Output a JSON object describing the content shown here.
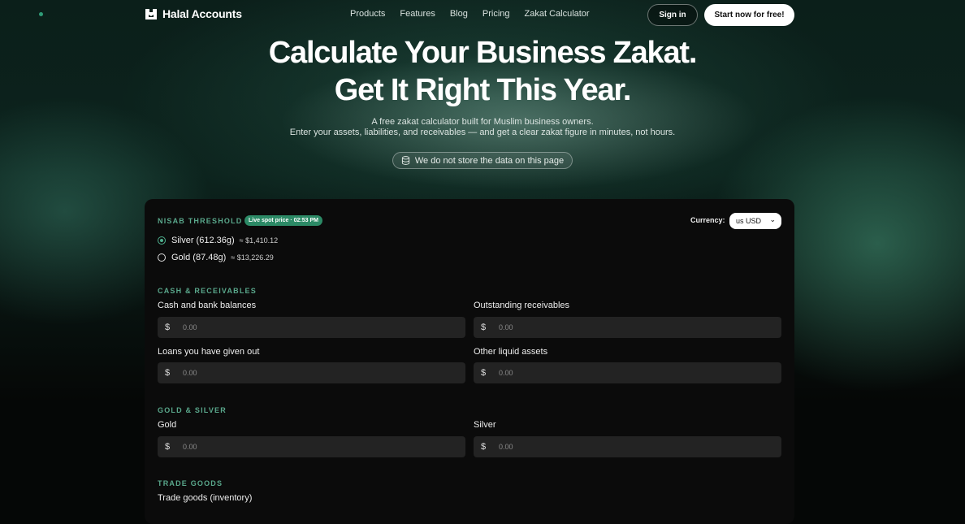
{
  "header": {
    "brand": "Halal Accounts",
    "nav": [
      "Products",
      "Features",
      "Blog",
      "Pricing",
      "Zakat Calculator"
    ],
    "sign_in": "Sign in",
    "start": "Start now for free!"
  },
  "hero": {
    "title_line1": "Calculate Your Business Zakat.",
    "title_line2": "Get It Right This Year.",
    "subtitle1": "A free zakat calculator built for Muslim business owners.",
    "subtitle2": "Enter your assets, liabilities, and receivables — and get a clear zakat figure in minutes, not hours.",
    "privacy_note": "We do not store the data on this page"
  },
  "calculator": {
    "nisab": {
      "title": "NISAB THRESHOLD",
      "badge": "Live spot price · 02:53 PM",
      "currency_label": "Currency:",
      "currency_value": "us USD",
      "options": [
        {
          "label": "Silver (612.36g)",
          "value": "≈ $1,410.12",
          "selected": true
        },
        {
          "label": "Gold (87.48g)",
          "value": "≈ $13,226.29",
          "selected": false
        }
      ]
    },
    "cash": {
      "title": "CASH & RECEIVABLES",
      "fields": [
        {
          "label": "Cash and bank balances",
          "currency": "$",
          "value": "0.00"
        },
        {
          "label": "Outstanding receivables",
          "currency": "$",
          "value": "0.00"
        },
        {
          "label": "Loans you have given out",
          "currency": "$",
          "value": "0.00"
        },
        {
          "label": "Other liquid assets",
          "currency": "$",
          "value": "0.00"
        }
      ]
    },
    "gold_silver": {
      "title": "GOLD & SILVER",
      "fields": [
        {
          "label": "Gold",
          "currency": "$",
          "value": "0.00"
        },
        {
          "label": "Silver",
          "currency": "$",
          "value": "0.00"
        }
      ]
    },
    "trade": {
      "title": "TRADE GOODS",
      "fields": [
        {
          "label": "Trade goods (inventory)"
        }
      ]
    }
  }
}
